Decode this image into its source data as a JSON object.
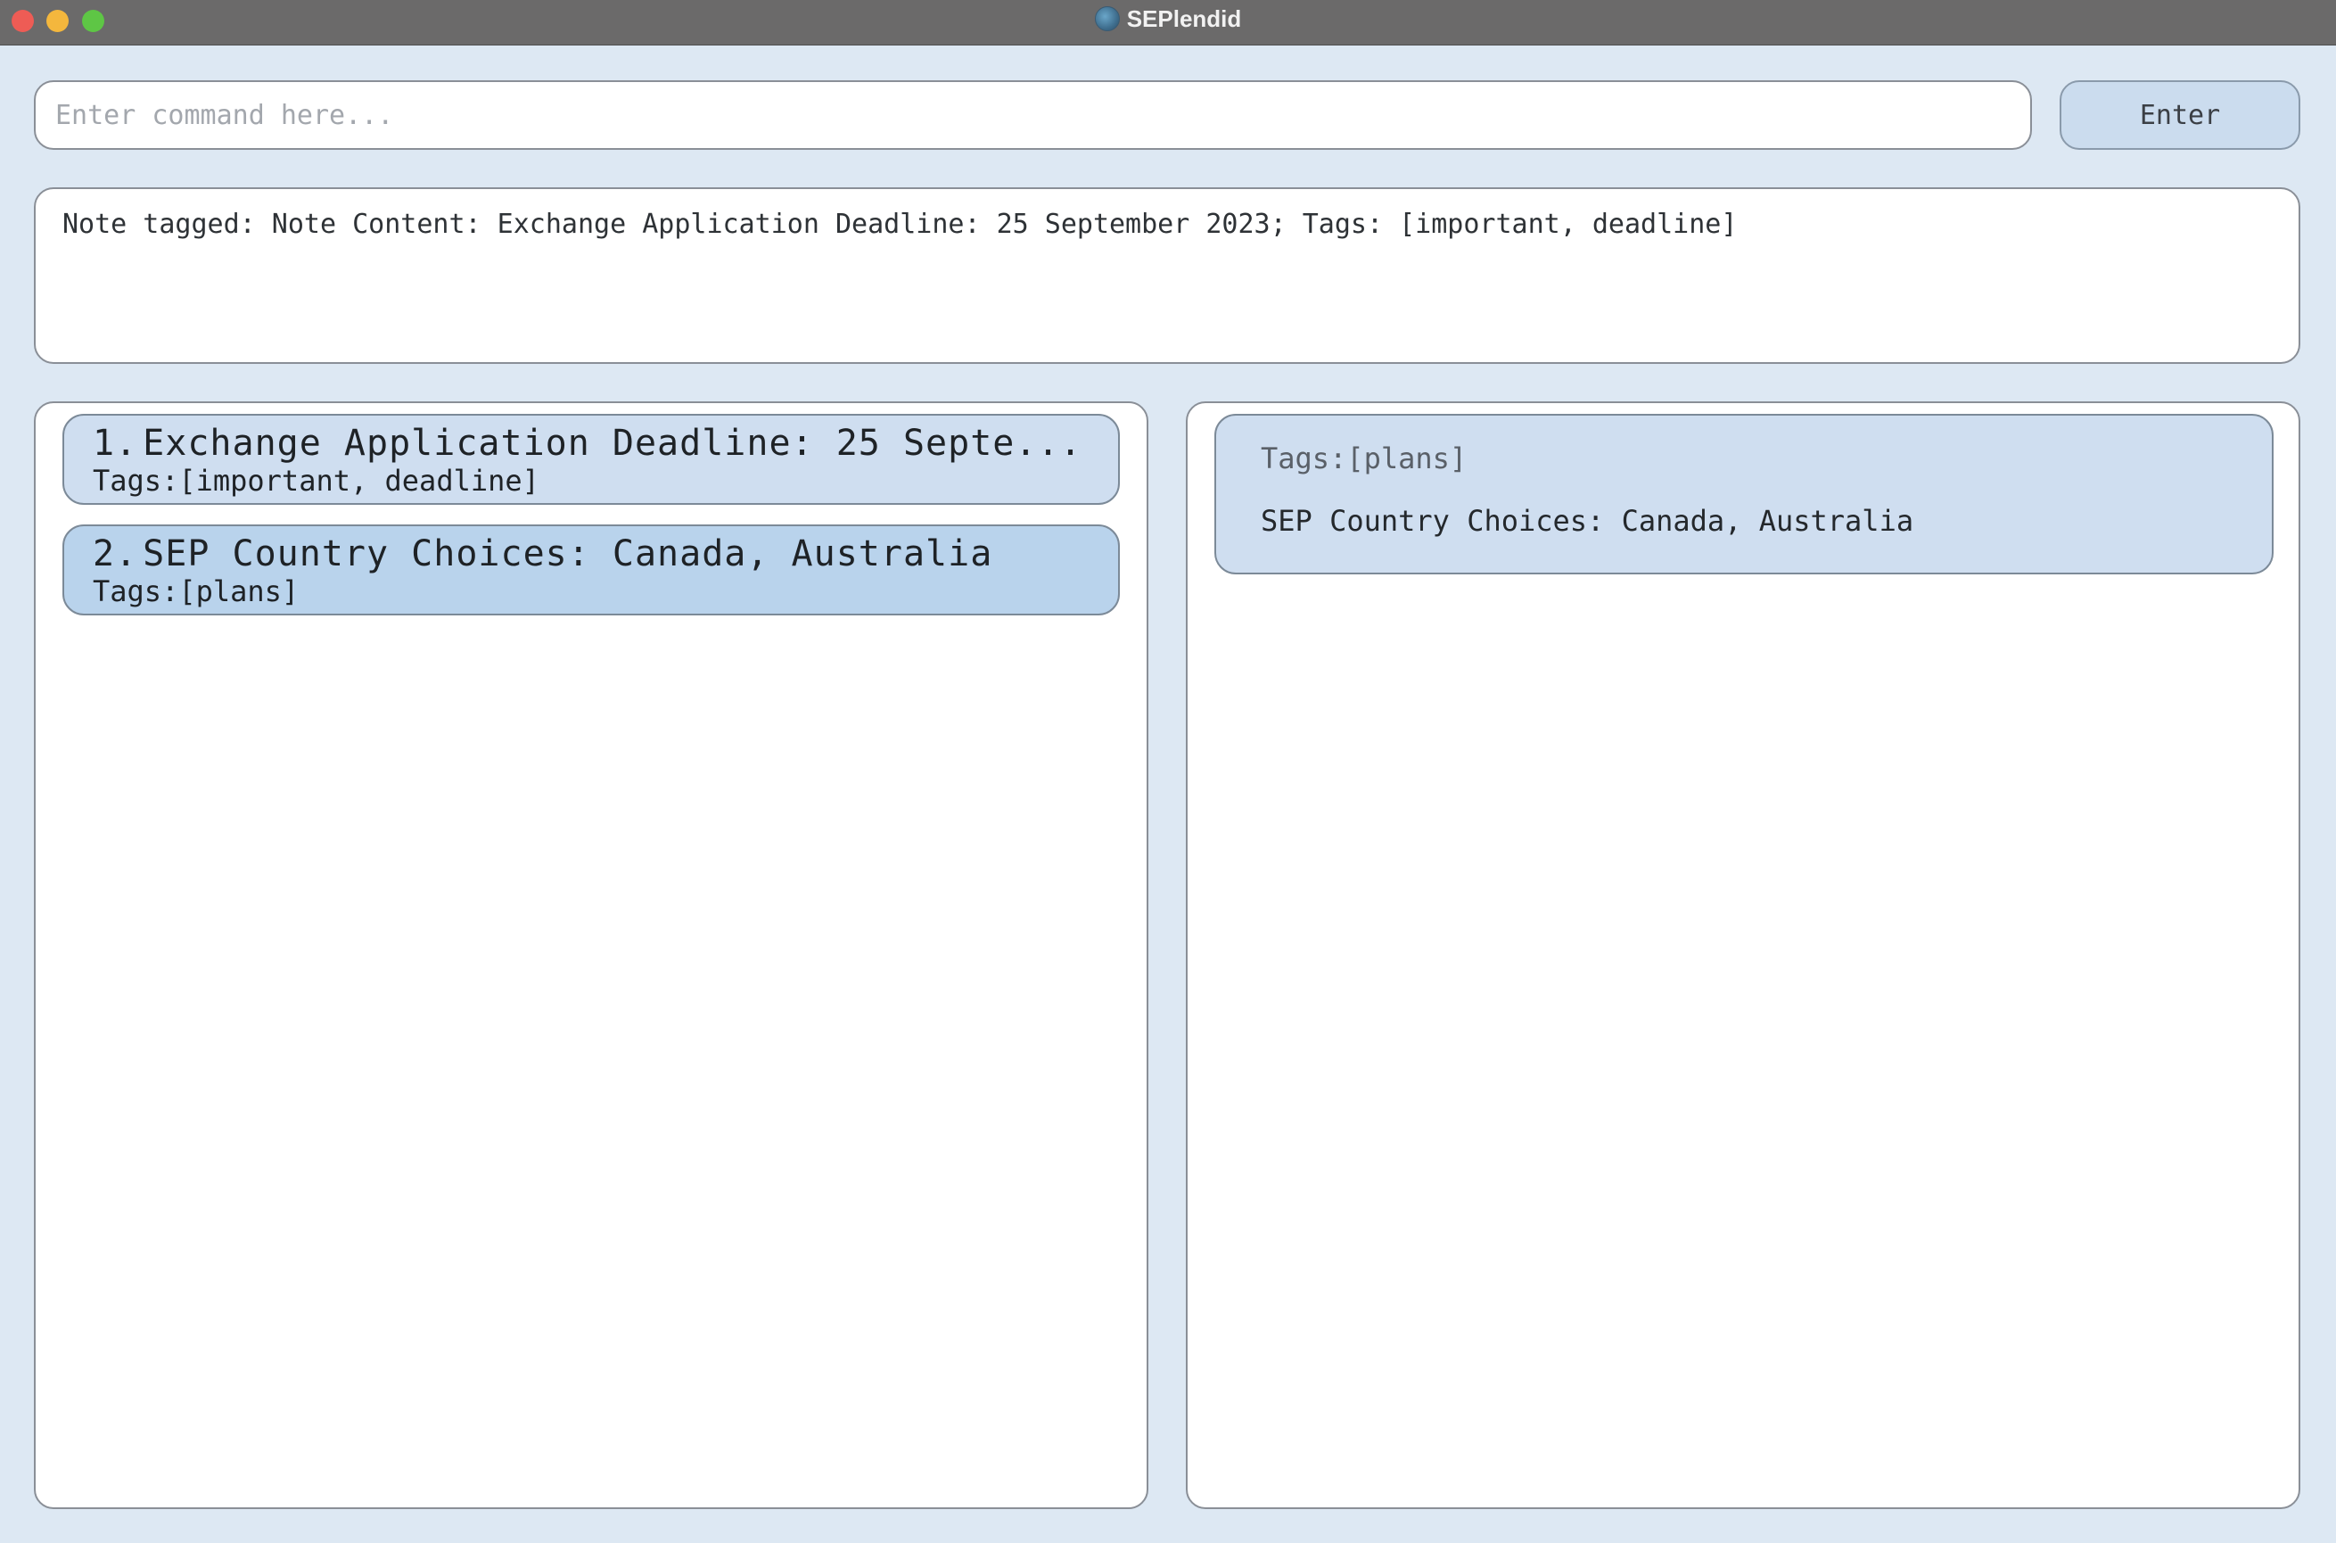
{
  "window": {
    "title": "SEPlendid"
  },
  "command": {
    "placeholder": "Enter command here...",
    "value": "",
    "enter_label": "Enter"
  },
  "result": {
    "text": "Note tagged: Note Content: Exchange Application Deadline: 25 September 2023; Tags: [important, deadline]"
  },
  "notes": [
    {
      "index": "1.",
      "title": "Exchange Application Deadline: 25 Septe...",
      "tags": "Tags:[important, deadline]"
    },
    {
      "index": "2.",
      "title": "SEP Country Choices: Canada, Australia",
      "tags": "Tags:[plans]"
    }
  ],
  "detail": {
    "tags": "Tags:[plans]",
    "content": "SEP Country Choices: Canada, Australia"
  },
  "colors": {
    "background": "#dde8f3",
    "card": "#cfdef0",
    "card_selected": "#b9d3ec",
    "titlebar": "#6b6a6a"
  }
}
